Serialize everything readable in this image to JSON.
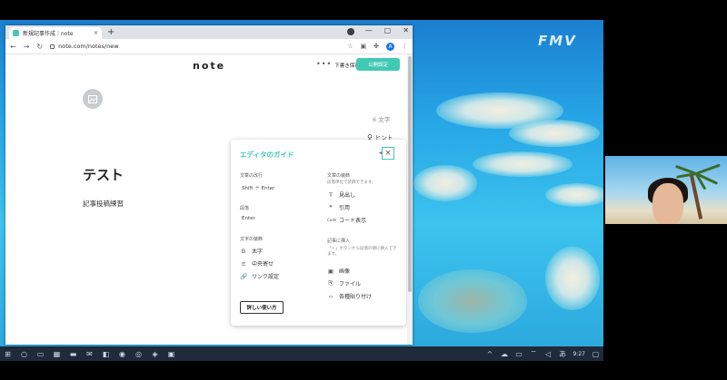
{
  "desktop": {
    "wallpaper_logo": "FMV"
  },
  "browser": {
    "tab_title": "新規記事作成｜note",
    "tab_close": "×",
    "new_tab": "+",
    "window_controls": [
      "—",
      "▢",
      "✕"
    ],
    "address": "note.com/notes/new",
    "profile_initial": "A"
  },
  "note": {
    "logo": "note",
    "more": "•••",
    "draft_label": "下書き保存",
    "publish_label": "公開設定",
    "char_count": "6 文字",
    "hint_label": "ヒント",
    "title": "テスト",
    "body": "記事投稿練習"
  },
  "guide": {
    "title": "エディタのガイド",
    "close": "×",
    "linebreak_head": "文章の改行",
    "linebreak_keys": "Shift ＋ Enter",
    "paragraph_head": "段落",
    "paragraph_key": "Enter",
    "decorate_head": "文字の装飾",
    "decorate_items": [
      {
        "icon": "B",
        "label": "太字"
      },
      {
        "icon": "≡",
        "label": "中央寄せ"
      },
      {
        "icon": "🔗",
        "label": "リンク設定"
      }
    ],
    "style_head": "文章の装飾",
    "style_note": "段落単位で装飾できます。",
    "style_items": [
      {
        "icon": "T",
        "label": "見出し"
      },
      {
        "icon": "❞",
        "label": "引用"
      },
      {
        "icon": "Code",
        "label": "コード表示"
      }
    ],
    "insert_head": "記事に挿入",
    "insert_note": "「＋」ボタンから段落の間に挿入できます。",
    "insert_items": [
      {
        "icon": "▣",
        "label": "画像"
      },
      {
        "icon": "⎘",
        "label": "ファイル"
      },
      {
        "icon": "‹›",
        "label": "各種貼り付け"
      }
    ],
    "detail_button": "詳しい使い方"
  },
  "taskbar": {
    "ime": "あ",
    "time": "9:27"
  }
}
